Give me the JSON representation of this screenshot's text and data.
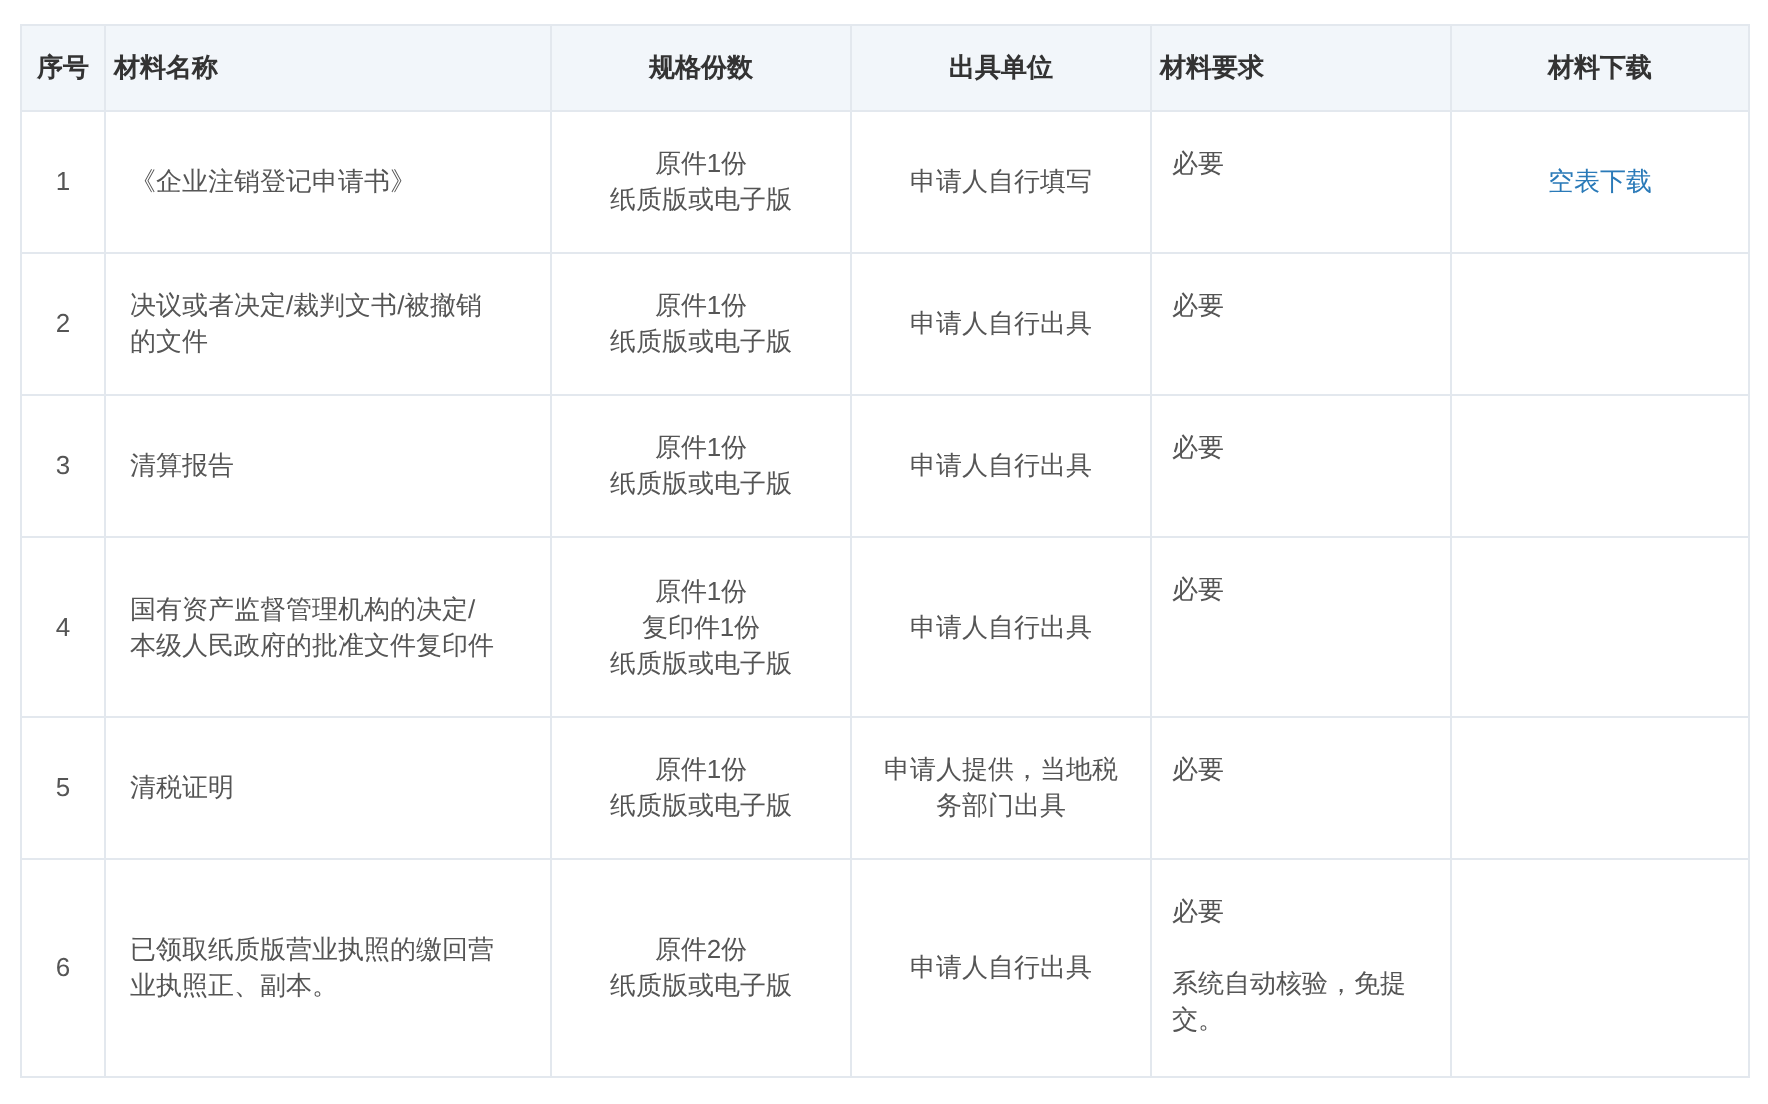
{
  "table": {
    "columns": [
      "序号",
      "材料名称",
      "规格份数",
      "出具单位",
      "材料要求",
      "材料下载"
    ],
    "rows": [
      {
        "index": "1",
        "name": "《企业注销登记申请书》",
        "spec": [
          "原件1份",
          "纸质版或电子版"
        ],
        "issuer": "申请人自行填写",
        "requirement": [
          "必要"
        ],
        "download": "空表下载"
      },
      {
        "index": "2",
        "name": "决议或者决定/裁判文书/被撤销的文件",
        "spec": [
          "原件1份",
          "纸质版或电子版"
        ],
        "issuer": "申请人自行出具",
        "requirement": [
          "必要"
        ]
      },
      {
        "index": "3",
        "name": "清算报告",
        "spec": [
          "原件1份",
          "纸质版或电子版"
        ],
        "issuer": "申请人自行出具",
        "requirement": [
          "必要"
        ]
      },
      {
        "index": "4",
        "name": "国有资产监督管理机构的决定/本级人民政府的批准文件复印件",
        "spec": [
          "原件1份",
          "复印件1份",
          "纸质版或电子版"
        ],
        "issuer": "申请人自行出具",
        "requirement": [
          "必要"
        ]
      },
      {
        "index": "5",
        "name": "清税证明",
        "spec": [
          "原件1份",
          "纸质版或电子版"
        ],
        "issuer": "申请人提供，当地税务部门出具",
        "requirement": [
          "必要"
        ]
      },
      {
        "index": "6",
        "name": "已领取纸质版营业执照的缴回营业执照正、副本。",
        "spec": [
          "原件2份",
          "纸质版或电子版"
        ],
        "issuer": "申请人自行出具",
        "requirement": [
          "必要",
          "系统自动核验，免提交。"
        ]
      }
    ]
  }
}
